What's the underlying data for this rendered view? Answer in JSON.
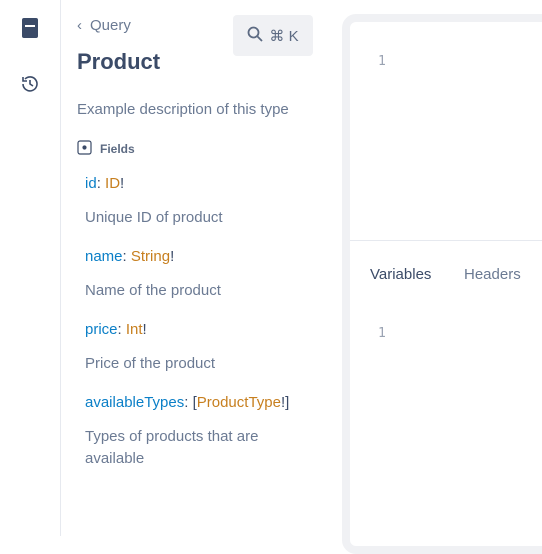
{
  "sidebar": {
    "items": [
      {
        "icon": "docs-book-icon"
      },
      {
        "icon": "history-icon"
      }
    ]
  },
  "docs": {
    "back_label": "Query",
    "search_label": "⌘ K",
    "title": "Product",
    "description": "Example description of this type",
    "fields_heading": "Fields",
    "fields": [
      {
        "name": "id",
        "colon": ": ",
        "type": "ID",
        "suffix": "!",
        "prefix": "",
        "description": "Unique ID of product"
      },
      {
        "name": "name",
        "colon": ": ",
        "type": "String",
        "suffix": "!",
        "prefix": "",
        "description": "Name of the product"
      },
      {
        "name": "price",
        "colon": ": ",
        "type": "Int",
        "suffix": "!",
        "prefix": "",
        "description": "Price of the product"
      },
      {
        "name": "availableTypes",
        "colon": ": ",
        "type": "ProductType",
        "suffix": "!]",
        "prefix": "[",
        "description": "Types of products that are available"
      }
    ]
  },
  "editor": {
    "query_line": "1",
    "tabs": [
      "Variables",
      "Headers"
    ],
    "variables_line": "1"
  }
}
